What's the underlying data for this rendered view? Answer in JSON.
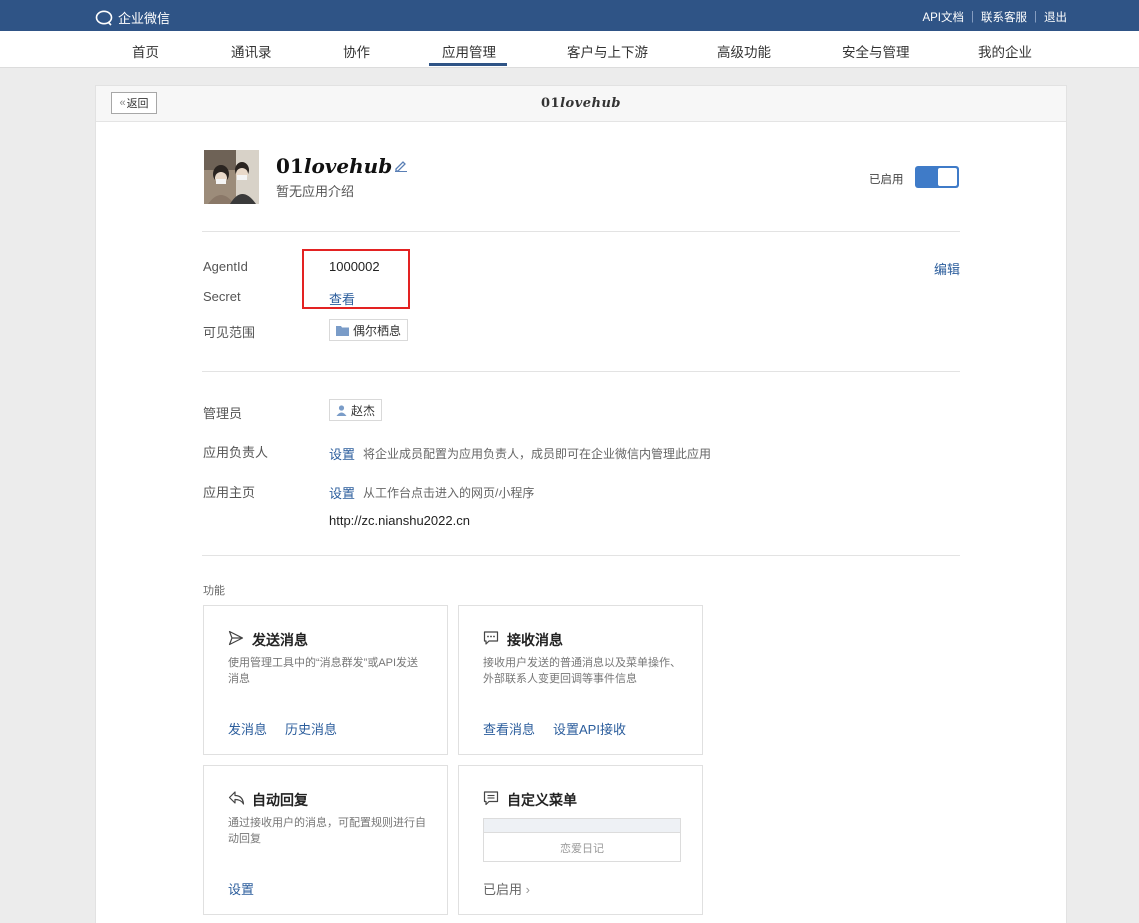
{
  "topbar": {
    "logo_text": "企业微信",
    "links": [
      "API文档",
      "联系客服",
      "退出"
    ]
  },
  "nav": {
    "items": [
      "首页",
      "通讯录",
      "协作",
      "应用管理",
      "客户与上下游",
      "高级功能",
      "安全与管理",
      "我的企业"
    ],
    "active_index": 3
  },
  "panel": {
    "back_label": "返回",
    "title_prefix": "01",
    "title_suffix": "lovehub"
  },
  "app": {
    "name_prefix": "01",
    "name_suffix": "lovehub",
    "description": "暂无应用介绍",
    "status_label": "已启用",
    "enabled": true
  },
  "details": {
    "agentid_label": "AgentId",
    "agentid_value": "1000002",
    "secret_label": "Secret",
    "secret_action": "查看",
    "visibility_label": "可见范围",
    "visibility_value": "偶尔栖息",
    "edit_label": "编辑"
  },
  "admin": {
    "admin_label": "管理员",
    "admin_value": "赵杰",
    "owner_label": "应用负责人",
    "owner_action": "设置",
    "owner_hint": "将企业成员配置为应用负责人，成员即可在企业微信内管理此应用",
    "homepage_label": "应用主页",
    "homepage_action": "设置",
    "homepage_hint": "从工作台点击进入的网页/小程序",
    "homepage_url": "http://zc.nianshu2022.cn"
  },
  "features": {
    "section_label": "功能",
    "cards": [
      {
        "icon": "send-icon",
        "title": "发送消息",
        "desc": "使用管理工具中的“消息群发”或API发送消息",
        "links": [
          "发消息",
          "历史消息"
        ]
      },
      {
        "icon": "chat-icon",
        "title": "接收消息",
        "desc": "接收用户发送的普通消息以及菜单操作、外部联系人变更回调等事件信息",
        "links": [
          "查看消息",
          "设置API接收"
        ]
      },
      {
        "icon": "reply-icon",
        "title": "自动回复",
        "desc": "通过接收用户的消息，可配置规则进行自动回复",
        "links": [
          "设置"
        ]
      },
      {
        "icon": "menu-icon",
        "title": "自定义菜单",
        "menu_preview": "恋爱日记",
        "status": "已启用"
      }
    ]
  }
}
